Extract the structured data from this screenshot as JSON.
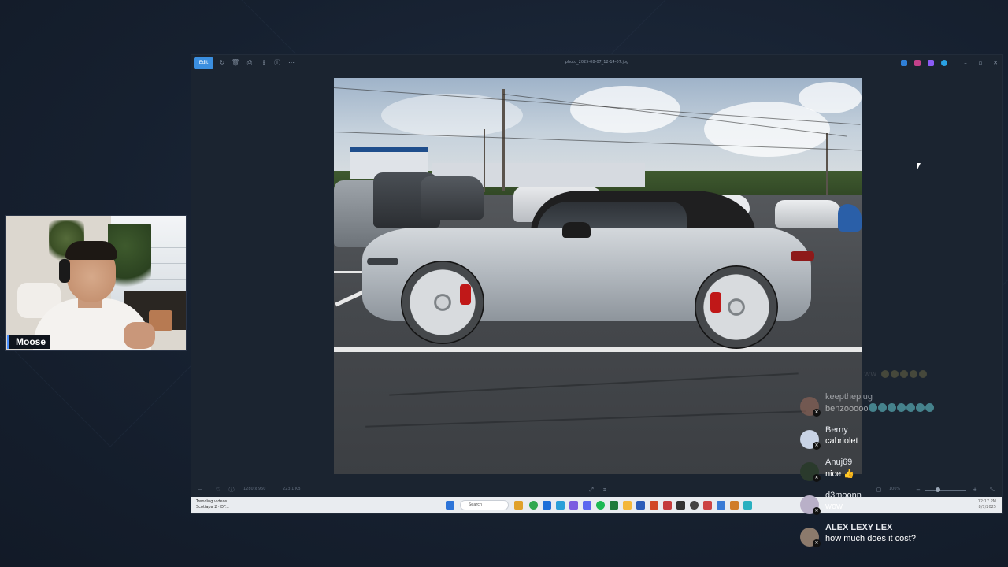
{
  "webcam": {
    "name": "Moose"
  },
  "window": {
    "title": "photo_2025-08-07_12-14-07.jpg",
    "edit_label": "Edit",
    "win_minimize": "–",
    "win_maximize": "▫",
    "win_close": "✕"
  },
  "statusbar": {
    "dimensions": "1280 x 960",
    "filesize": "223.1 KB",
    "zoom": "100%"
  },
  "taskbar": {
    "news_title": "Trending videos",
    "news_sub": "Scotiapa 2 · DF...",
    "search_placeholder": "Search",
    "time": "12:17 PM",
    "date": "8/7/2025"
  },
  "chat": {
    "faded_top": "ww",
    "messages": [
      {
        "user": "keeptheplug",
        "text": "benzooooo",
        "emote_count": 7,
        "avatar_color": "#9b6a5a"
      },
      {
        "user": "Berny",
        "text": "cabriolet",
        "emote_count": 0,
        "avatar_color": "#c9d4e6"
      },
      {
        "user": "Anuj69",
        "text": "nice 👍",
        "emote_count": 0,
        "avatar_color": "#2a3a2c"
      },
      {
        "user": "d3moonn",
        "text": "wow",
        "emote_count": 0,
        "avatar_color": "#b9b0c8"
      },
      {
        "user": "ALEX LEXY LEX",
        "text": "how much does it cost?",
        "emote_count": 0,
        "avatar_color": "#8c7a6c"
      }
    ]
  },
  "icons": {
    "edit": "edit-icon",
    "rotate": "rotate-icon",
    "delete": "trash-icon",
    "print": "print-icon",
    "info": "info-icon",
    "more": "more-icon"
  }
}
